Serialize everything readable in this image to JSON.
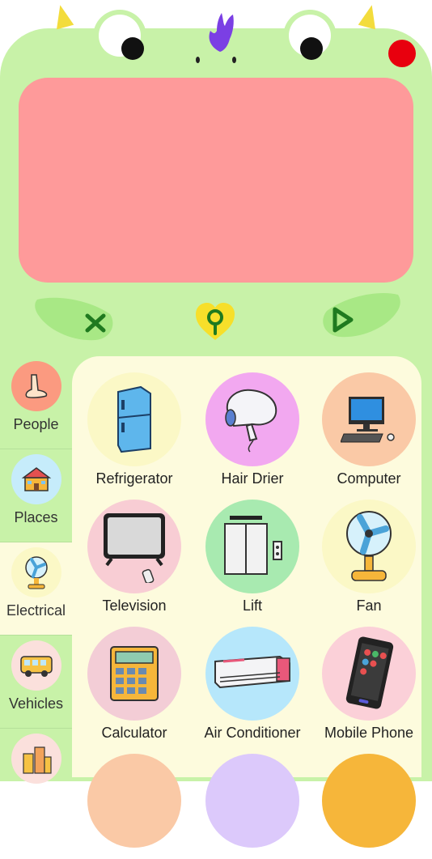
{
  "header": {
    "controls": {
      "clear_icon": "close-icon",
      "favorite_icon": "heart-location-icon",
      "play_icon": "play-icon"
    },
    "colors": {
      "body": "#c8f2a8",
      "screen": "#fe9a9a",
      "record_dot": "#e8000e",
      "horns": "#f3dc3c",
      "crest": "#7b3fe4"
    }
  },
  "sidebar": {
    "categories": [
      {
        "label": "People",
        "icon": "foot-icon",
        "active": false
      },
      {
        "label": "Places",
        "icon": "school-icon",
        "active": false
      },
      {
        "label": "Electrical",
        "icon": "fan-icon",
        "active": true
      },
      {
        "label": "Vehicles",
        "icon": "bus-icon",
        "active": false
      },
      {
        "label": "",
        "icon": "buildings-icon",
        "active": false
      }
    ]
  },
  "grid": {
    "items": [
      {
        "label": "Refrigerator",
        "icon": "refrigerator-icon",
        "color": "#fbf8c6"
      },
      {
        "label": "Hair Drier",
        "icon": "hair-drier-icon",
        "color": "#f2a8f0"
      },
      {
        "label": "Computer",
        "icon": "computer-icon",
        "color": "#fac9a6"
      },
      {
        "label": "Television",
        "icon": "television-icon",
        "color": "#f8cdd4"
      },
      {
        "label": "Lift",
        "icon": "lift-icon",
        "color": "#a8eab0"
      },
      {
        "label": "Fan",
        "icon": "fan-icon",
        "color": "#fbf8c6"
      },
      {
        "label": "Calculator",
        "icon": "calculator-icon",
        "color": "#f3cdd6"
      },
      {
        "label": "Air Conditioner",
        "icon": "air-conditioner-icon",
        "color": "#b6e7fb"
      },
      {
        "label": "Mobile Phone",
        "icon": "mobile-phone-icon",
        "color": "#fbd0d8"
      }
    ]
  }
}
